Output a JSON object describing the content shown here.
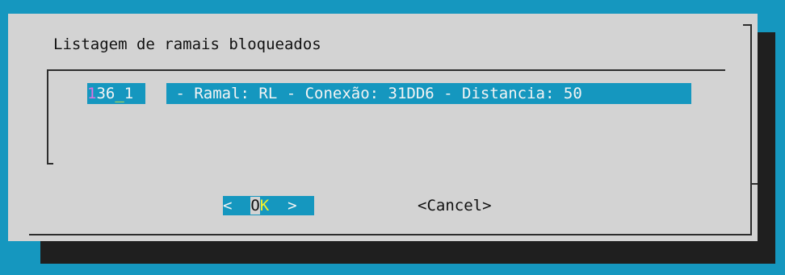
{
  "dialog": {
    "title": "Listagem de ramais bloqueados",
    "list_item": {
      "tag_part1": "1",
      "tag_part2": "36",
      "tag_cursor": "_",
      "tag_part3": "1",
      "description": " - Ramal: RL - Conexão: 31DD6 - Distancia: 50"
    },
    "buttons": {
      "ok_left": "<  ",
      "ok_o": "O",
      "ok_k": "K",
      "ok_right": "  >",
      "cancel": "<Cancel>"
    }
  },
  "colors": {
    "background": "#1597bf",
    "dialog": "#d3d3d3",
    "shadow": "#1f1f1f",
    "highlight": "#1597bf",
    "hotkey": "#f2f22a"
  }
}
